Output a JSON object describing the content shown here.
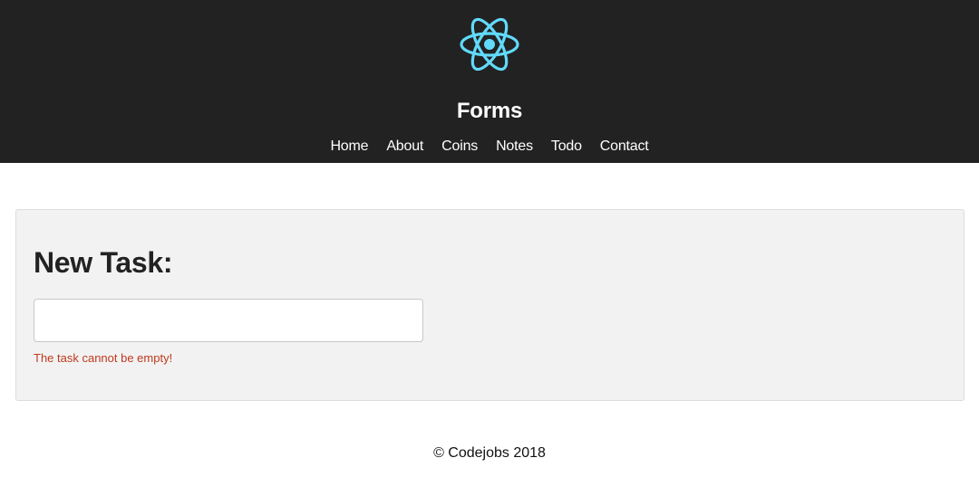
{
  "header": {
    "logo_icon": "react-atom-icon",
    "logo_color": "#61dafb",
    "background": "#222222",
    "title": "Forms",
    "nav": [
      {
        "label": "Home"
      },
      {
        "label": "About"
      },
      {
        "label": "Coins"
      },
      {
        "label": "Notes"
      },
      {
        "label": "Todo"
      },
      {
        "label": "Contact"
      }
    ]
  },
  "form": {
    "heading": "New Task:",
    "task_value": "",
    "error": "The task cannot be empty!",
    "error_color": "#c0391f"
  },
  "footer": {
    "text": "© Codejobs 2018"
  }
}
